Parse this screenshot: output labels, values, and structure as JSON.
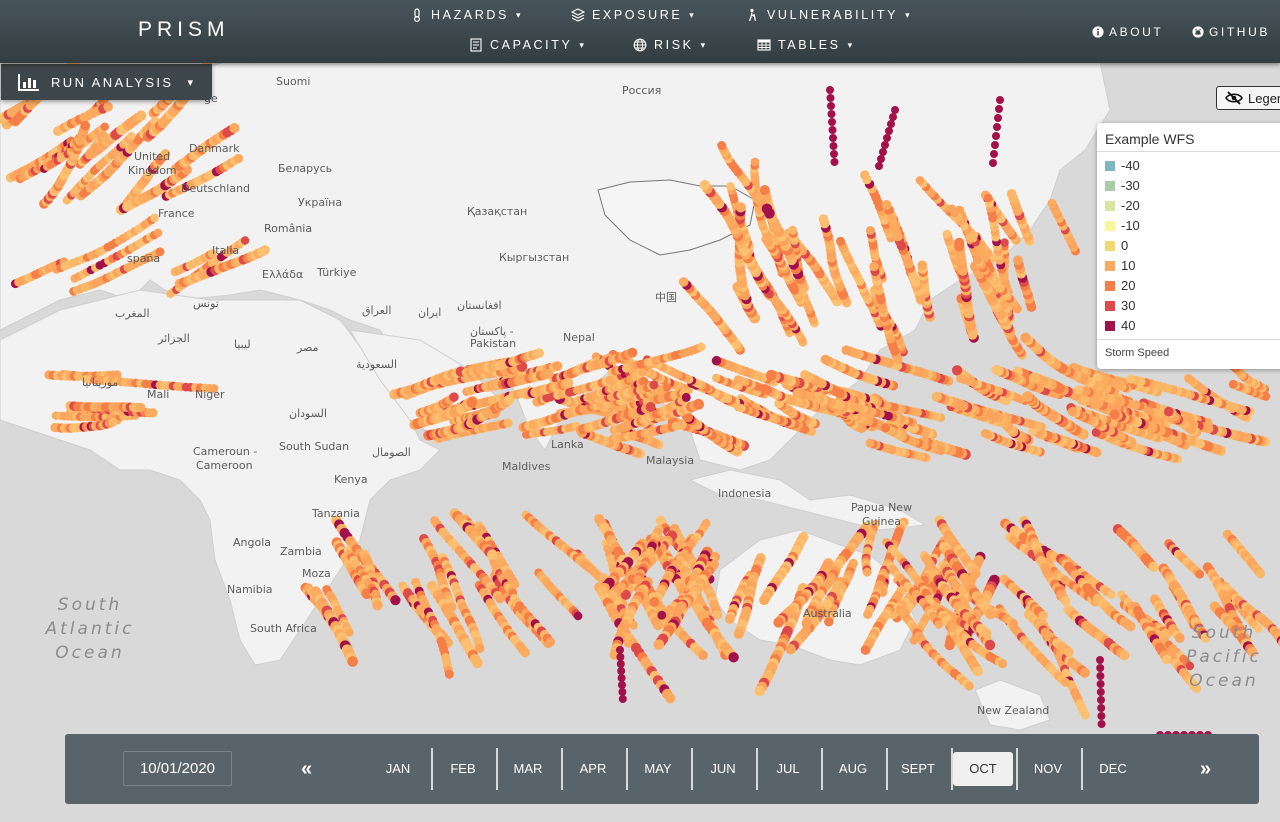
{
  "app": {
    "brand": "PRISM"
  },
  "nav": {
    "hazards": "HAZARDS",
    "exposure": "EXPOSURE",
    "vulnerability": "VULNERABILITY",
    "capacity": "CAPACITY",
    "risk": "RISK",
    "tables": "TABLES",
    "about": "ABOUT",
    "github": "GITHUB",
    "caret": "▾"
  },
  "analysis": {
    "label": "RUN ANALYSIS"
  },
  "legend": {
    "toggle_label": "Legend",
    "title": "Example WFS",
    "items": [
      {
        "label": "-40",
        "color": "#7fb5c3"
      },
      {
        "label": "-30",
        "color": "#a8cba8"
      },
      {
        "label": "-20",
        "color": "#d8e7a0"
      },
      {
        "label": "-10",
        "color": "#f8f59a"
      },
      {
        "label": "0",
        "color": "#f1d873"
      },
      {
        "label": "10",
        "color": "#fbaa5f"
      },
      {
        "label": "20",
        "color": "#f57f46"
      },
      {
        "label": "30",
        "color": "#de4a4a"
      },
      {
        "label": "40",
        "color": "#a2114a"
      }
    ],
    "footer": "Storm Speed"
  },
  "map_labels": {
    "russia": "Россия",
    "finland": "Suomi",
    "norway": "ge",
    "danmark": "Danmark",
    "uk_1": "United",
    "uk_2": "Kingdom",
    "belarus": "Беларусь",
    "germany": "Deutschland",
    "ukraine": "Україна",
    "france": "France",
    "romania": "România",
    "kazakhstan": "Қазақстан",
    "italia": "Italia",
    "espana": "spaña",
    "greece": "Ελλάδα",
    "turkey": "Türkiye",
    "kyrgyzstan": "Кыргызстан",
    "tunisia": "تونس",
    "morocco": "المغرب",
    "iraq": "العراق",
    "iran": "ایران",
    "afghanistan": "افغانستان",
    "china": "中国",
    "algeria": "الجزائر",
    "libya": "ليبيا",
    "egypt": "مصر",
    "pakistan": "پاکستان - Pakistan",
    "nepal": "Nepal",
    "saudi": "السعودية",
    "mauritania": "موريتانيا",
    "mali": "Mali",
    "niger": "Niger",
    "sudan": "السودان",
    "cameroon_1": "Cameroun -",
    "cameroon_2": "Cameroon",
    "south_sudan": "South Sudan",
    "somalia": "الصومال",
    "maldives": "Maldives",
    "kenya": "Kenya",
    "indonesia": "Indonesia",
    "png_1": "Papua New",
    "png_2": "Guinea",
    "tanzania": "Tanzania",
    "angola": "Angola",
    "zambia": "Zambia",
    "mozambique": "Moza",
    "namibia": "Namibia",
    "australia": "Australia",
    "south_africa": "South Africa",
    "new_zealand": "New Zealand",
    "malaysia": "Malaysia",
    "sri_lanka": "Lanka",
    "south_atlantic": "South\nAtlantic\nOcean",
    "south_pacific": "South\nPacific\nOcean"
  },
  "timeline": {
    "date": "10/01/2020",
    "prev": "«",
    "next": "»",
    "months": [
      "JAN",
      "FEB",
      "MAR",
      "APR",
      "MAY",
      "JUN",
      "JUL",
      "AUG",
      "SEPT",
      "OCT",
      "NOV",
      "DEC"
    ],
    "active": "OCT"
  }
}
